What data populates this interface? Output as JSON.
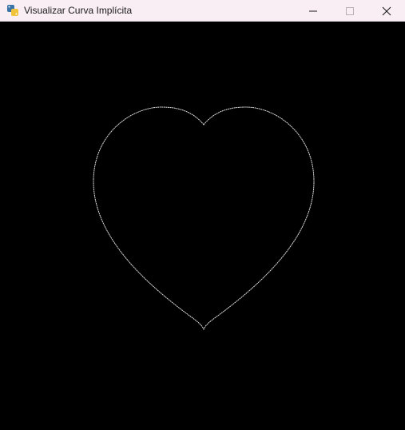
{
  "window": {
    "title": "Visualizar Curva Implícita",
    "app_icon": "python-icon",
    "controls": [
      "minimize-icon",
      "maximize-icon",
      "close-icon"
    ]
  },
  "canvas": {
    "background_color": "#000000",
    "curve_color": "#d9d9d9",
    "curve_shape": "heart"
  }
}
